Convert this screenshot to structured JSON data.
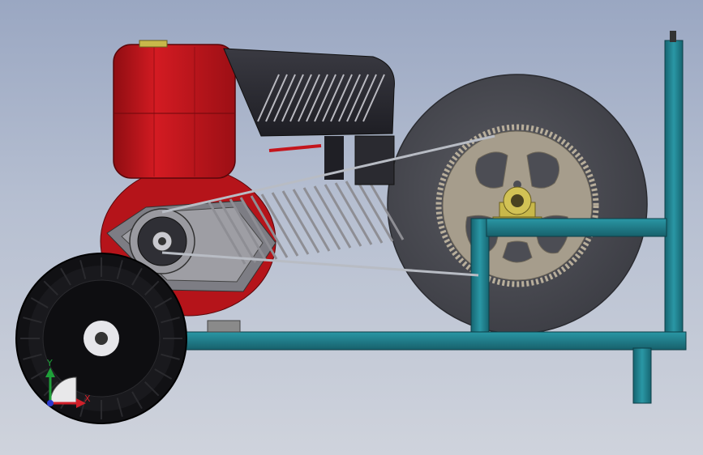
{
  "viewport": {
    "background_top": "#9aa7c2",
    "background_bottom": "#cfd3dc"
  },
  "colors": {
    "frame_teal": "#1f7f8c",
    "frame_edge": "#0d3e47",
    "tank_red": "#c4151c",
    "engine_dark": "#2a2a30",
    "fins_gray": "#9a9aa0",
    "sprocket_gray": "#a39a8a",
    "disc_gray": "#4c4d54",
    "tire_black": "#111114",
    "bearing_yellow": "#c8b84a",
    "belt_gray": "#b8bcc4"
  },
  "triad": {
    "x_label": "X",
    "y_label": "Y",
    "x_color": "#d0202a",
    "y_color": "#1fa03a",
    "z_color": "#2a3ad0"
  },
  "parts": [
    "fuel-tank",
    "engine-cover",
    "cylinder-fins",
    "crankcase",
    "drive-pulley",
    "front-wheel",
    "brake-disc",
    "rear-sprocket",
    "bearing-block",
    "steel-frame",
    "drive-belt"
  ]
}
